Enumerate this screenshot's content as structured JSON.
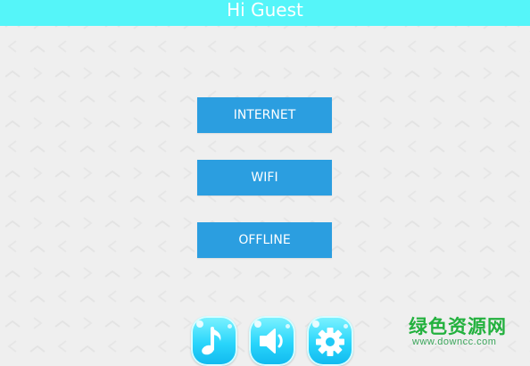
{
  "header": {
    "title": "Hi Guest",
    "color": "#55f5f9"
  },
  "menu": {
    "items": [
      {
        "label": "INTERNET"
      },
      {
        "label": "WIFI"
      },
      {
        "label": "OFFLINE"
      }
    ],
    "button_color": "#2b9ee0"
  },
  "bottom_bar": {
    "icons": [
      "music-note-icon",
      "speaker-icon",
      "gear-icon"
    ]
  },
  "watermark": {
    "line1": "绿色资源网",
    "line2": "www.downcc.com"
  }
}
